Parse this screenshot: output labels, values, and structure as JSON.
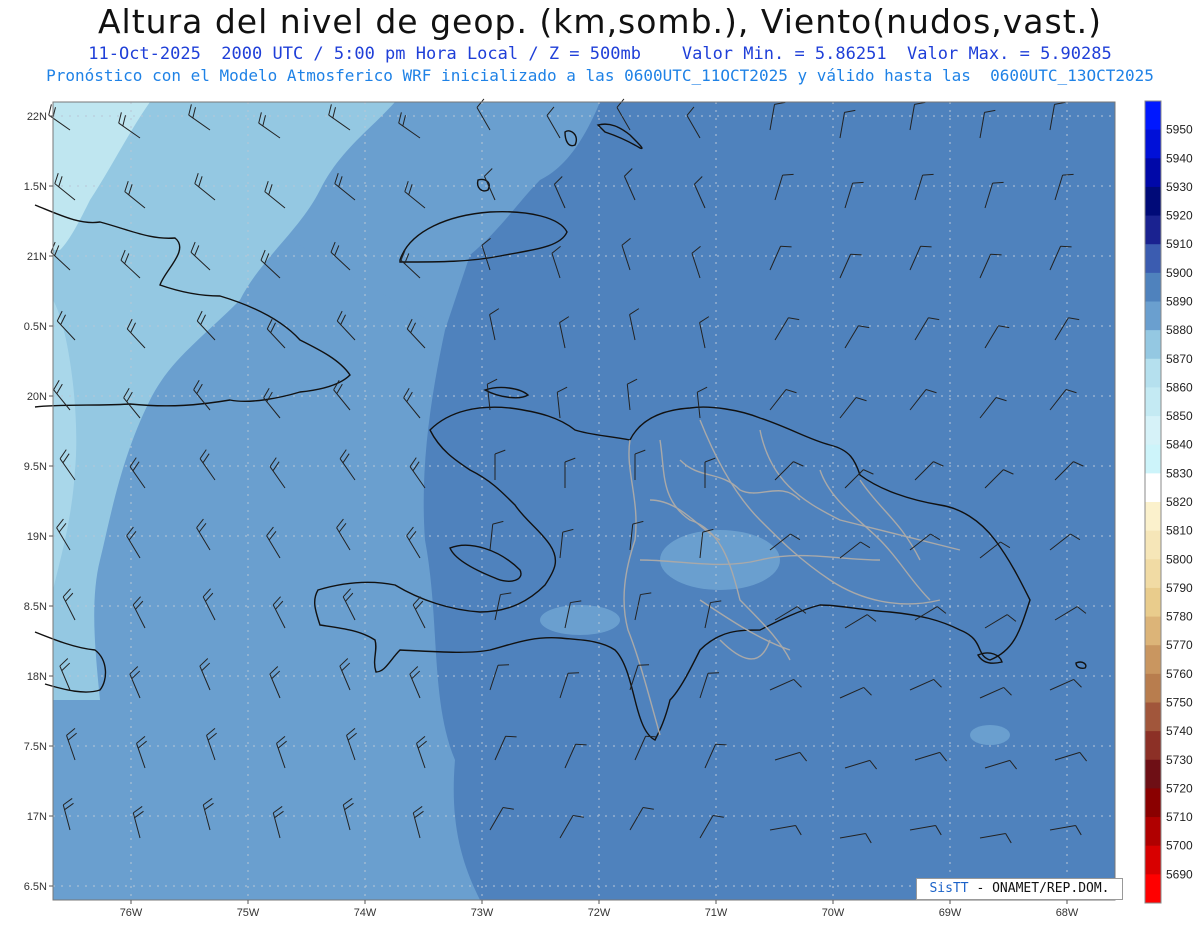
{
  "header": {
    "title": "Altura del nivel de geop. (km,somb.), Viento(nudos,vast.)",
    "line1": "11-Oct-2025  2000 UTC / 5:00 pm Hora Local / Z = 500mb    Valor Min. = 5.86251  Valor Max. = 5.90285",
    "line2": "Pronóstico con el Modelo Atmosferico WRF inicializado a las 0600UTC_11OCT2025 y válido hasta las  0600UTC_13OCT2025"
  },
  "map": {
    "lat_labels": [
      "22N",
      "1.5N",
      "21N",
      "0.5N",
      "20N",
      "9.5N",
      "19N",
      "8.5N",
      "18N",
      "7.5N",
      "17N",
      "6.5N"
    ],
    "lon_labels": [
      "76W",
      "75W",
      "74W",
      "73W",
      "72W",
      "71W",
      "70W",
      "69W",
      "68W"
    ],
    "colors": {
      "lightest": "#bfe6f0",
      "light": "#94c8e2",
      "mid": "#6a9fcf",
      "main": "#4f82bd",
      "coast": "#111111",
      "borders": "#a9a9a9"
    }
  },
  "colorbar": {
    "labels": [
      "5950",
      "5940",
      "5930",
      "5920",
      "5910",
      "5900",
      "5890",
      "5880",
      "5870",
      "5860",
      "5850",
      "5840",
      "5830",
      "5820",
      "5810",
      "5800",
      "5790",
      "5780",
      "5770",
      "5760",
      "5750",
      "5740",
      "5730",
      "5720",
      "5710",
      "5700",
      "5690"
    ],
    "colors": [
      "#0018ff",
      "#0010d8",
      "#0008a8",
      "#000a78",
      "#1a2290",
      "#3b5cb0",
      "#4f82bd",
      "#6a9fcf",
      "#94c8e2",
      "#b5e0ee",
      "#c4eaf3",
      "#d6f2f8",
      "#cdf4fa",
      "#ffffff",
      "#fbf1cc",
      "#f6e6b8",
      "#f1dba4",
      "#e9cc8c",
      "#dcb478",
      "#c99660",
      "#b87d4e",
      "#a1563b",
      "#8c3026",
      "#6e0f15",
      "#8a0000",
      "#b00000",
      "#d80000",
      "#ff0000"
    ]
  },
  "credit": {
    "brand": "SisTT",
    "text": "- ONAMET/REP.DOM."
  }
}
